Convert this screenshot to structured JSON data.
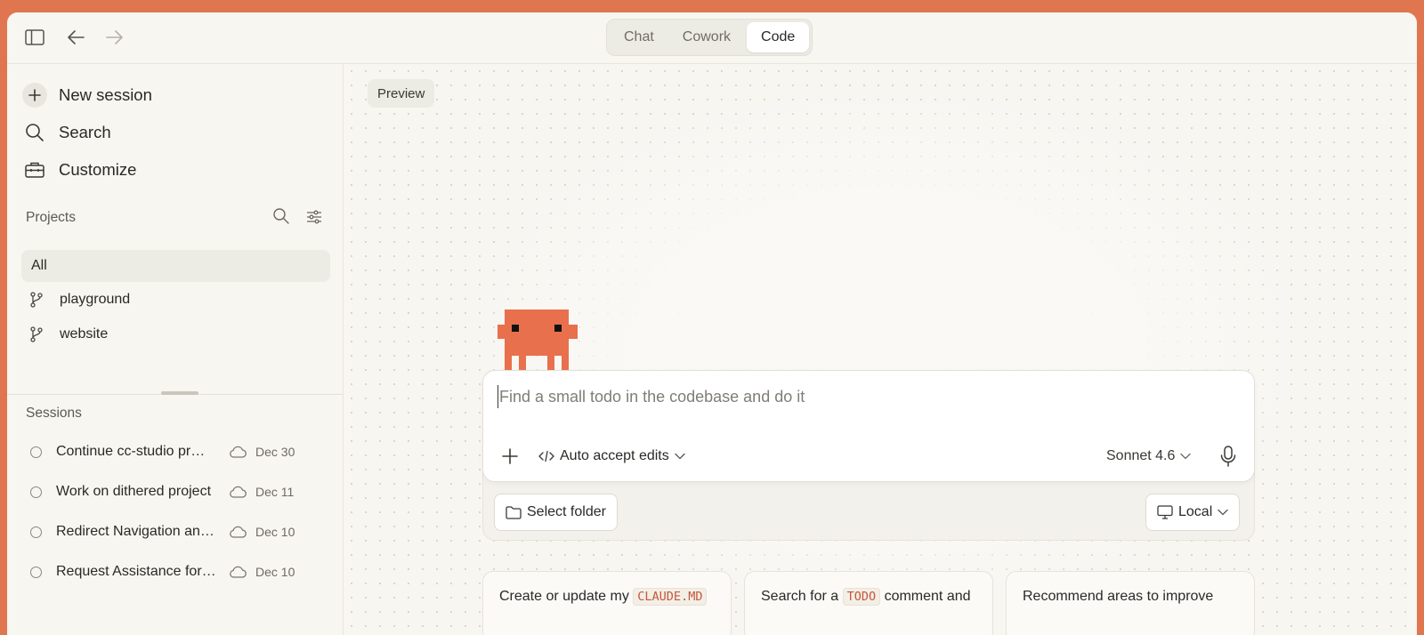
{
  "titlebar": {
    "tabs": [
      {
        "label": "Chat",
        "active": false
      },
      {
        "label": "Cowork",
        "active": false
      },
      {
        "label": "Code",
        "active": true
      }
    ]
  },
  "sidebar": {
    "nav": {
      "new_session": "New session",
      "search": "Search",
      "customize": "Customize"
    },
    "projects": {
      "title": "Projects",
      "all_label": "All",
      "items": [
        "playground",
        "website"
      ]
    },
    "sessions": {
      "title": "Sessions",
      "items": [
        {
          "title": "Continue cc-studio pr…",
          "date": "Dec 30"
        },
        {
          "title": "Work on dithered project",
          "date": "Dec 11"
        },
        {
          "title": "Redirect Navigation an…",
          "date": "Dec 10"
        },
        {
          "title": "Request Assistance for…",
          "date": "Dec 10"
        }
      ]
    }
  },
  "main": {
    "preview_label": "Preview",
    "composer": {
      "placeholder": "Find a small todo in the codebase and do it",
      "mode_label": "Auto accept edits",
      "model_label": "Sonnet 4.6"
    },
    "select_folder_label": "Select folder",
    "environment_label": "Local",
    "suggestions": [
      {
        "prefix": "Create or update my ",
        "code": "CLAUDE.MD",
        "suffix": ""
      },
      {
        "prefix": "Search for a ",
        "code": "TODO",
        "suffix": " comment and"
      },
      {
        "prefix": "Recommend areas to improve",
        "code": "",
        "suffix": ""
      }
    ]
  },
  "colors": {
    "background": "#e0764f",
    "accent": "#e8704c",
    "surface": "#f8f6f1"
  }
}
